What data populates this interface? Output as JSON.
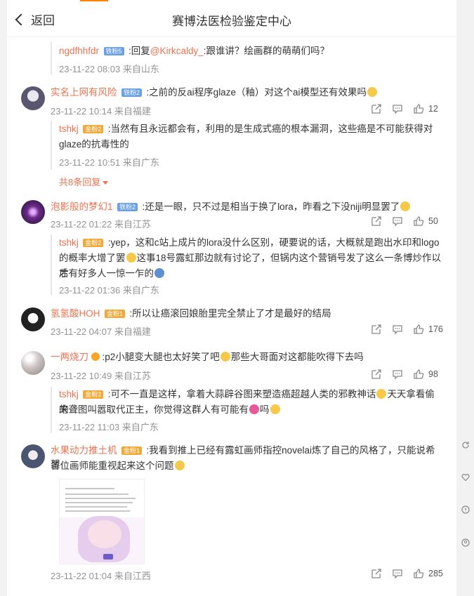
{
  "header": {
    "back_label": "返回",
    "title": "赛博法医检验鉴定中心"
  },
  "reply0": {
    "name": "ngdfhhfdr",
    "badge": "铁粉5",
    "prefix": ":回复",
    "mention": "@Kirkcaldy_",
    "text": ":跟谁讲？绘画群的萌萌们吗？",
    "meta": "23-11-22 08:03 来自山东"
  },
  "comments": [
    {
      "name": "实名上网有风险",
      "badge": "铁粉2",
      "text": ":之前的反ai程序glaze（釉）对这个ai模型还有效果吗",
      "meta": "23-11-22 10:14 来自福建",
      "likes": "12",
      "reply": {
        "name": "tshkj",
        "badge": "金粉2",
        "text1": ":当然有且永远都会有，利用的是生成式癌的根本漏洞，这些癌是不可能获得对",
        "text2": "glaze的抗毒性的",
        "meta": "23-11-22 10:51 来自广东"
      },
      "more": "共8条回复"
    },
    {
      "name": "泡影般的梦幻1",
      "badge": "铁粉2",
      "text": ":还是一眼，只不过是相当于换了lora，昨看之下没niji明显罢了",
      "meta": "23-11-22 01:22 来自江苏",
      "likes": "50",
      "reply": {
        "name": "tshkj",
        "badge": "金粉2",
        "text1": ":yep，这和c站上成片的lora没什么区别，硬要说的话，大概就是跑出水印和logo",
        "text2": "的概率大增了罢",
        "text2b": "这事18号露虹那边就有讨论了，但锅内这个营销号发了这么一条博炒作以后",
        "text3": "才有好多人一惊一乍的",
        "meta": "23-11-22 01:36 来自广东"
      }
    },
    {
      "name": "氢氢酸HOH",
      "badge": "金粉1",
      "text": ":所以让癌滚回娘胎里完全禁止了才是最好的结局",
      "meta": "23-11-22 04:07 来自福建",
      "likes": "176"
    },
    {
      "name": "一两烧刀",
      "text": ":p2小腿变大腿也太好笑了吧",
      "text_b": "那些大哥面对这都能吹得下去吗",
      "meta": "23-11-22 10:49 来自江苏",
      "likes": "98",
      "reply": {
        "name": "tshkj",
        "badge": "金粉2",
        "text1": ":可不一直是这样，拿着大蒜辟谷图来塑造癌超越人类的邪教神话",
        "text1b": "天天拿看偷来",
        "text2": "的聋图叫嚣取代正主，你觉得这群人有可能有",
        "text2b": "吗",
        "meta": "23-11-22 11:03 来自广东"
      }
    },
    {
      "name": "水果动力推土机",
      "badge": "金粉1",
      "text1": ":我看到推上已经有露虹画师指控novelai炼了自己的风格了，只能说希望",
      "text2": "各位画师能重视起来这个问题",
      "meta": "23-11-22 01:04 来自江西",
      "likes": "285"
    }
  ],
  "icons": {
    "share": "share-icon",
    "comment": "comment-icon",
    "like": "thumbs-up-icon",
    "back": "chevron-left-icon"
  },
  "colors": {
    "name": "#eb7350",
    "accent": "#ff8200",
    "meta": "#939393"
  }
}
